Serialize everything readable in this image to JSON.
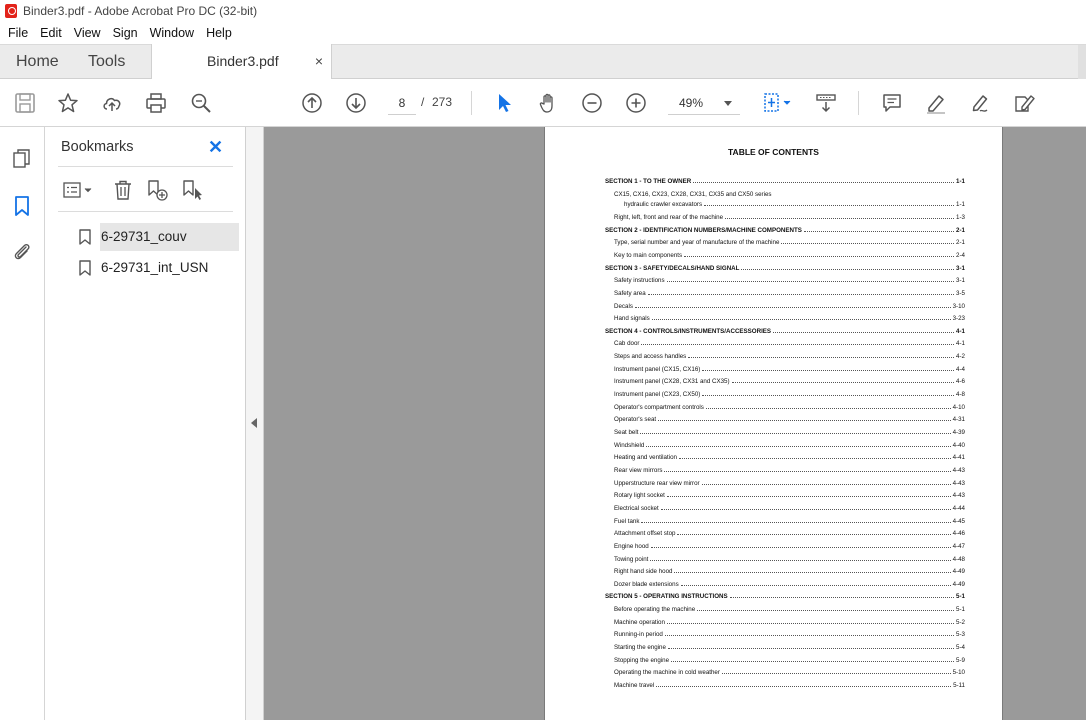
{
  "window": {
    "title": "Binder3.pdf - Adobe Acrobat Pro DC (32-bit)"
  },
  "menu": [
    "File",
    "Edit",
    "View",
    "Sign",
    "Window",
    "Help"
  ],
  "tabs": {
    "home": "Home",
    "tools": "Tools",
    "document": "Binder3.pdf",
    "close": "×"
  },
  "toolbar": {
    "page_current": "8",
    "page_separator": "/",
    "page_total": "273",
    "zoom": "49%"
  },
  "bookmarks": {
    "title": "Bookmarks",
    "items": [
      {
        "label": "6-29731_couv",
        "selected": true
      },
      {
        "label": "6-29731_int_USN",
        "selected": false
      }
    ]
  },
  "document": {
    "toc_title": "TABLE OF CONTENTS",
    "entries": [
      {
        "text": "SECTION 1 - TO THE OWNER",
        "page": "1-1",
        "section": true
      },
      {
        "text": "CX15, CX16, CX23, CX28, CX31, CX35 and CX50 series",
        "page": "",
        "section": false,
        "nodots": true
      },
      {
        "text": "hydraulic crawler excavators",
        "page": "1-1",
        "section": false,
        "indent2": true
      },
      {
        "text": "Right, left, front and rear of the machine",
        "page": "1-3",
        "section": false
      },
      {
        "text": "SECTION 2 - IDENTIFICATION NUMBERS/MACHINE COMPONENTS",
        "page": "2-1",
        "section": true
      },
      {
        "text": "Type, serial number and year of manufacture of the machine",
        "page": "2-1",
        "section": false
      },
      {
        "text": "Key to main components",
        "page": "2-4",
        "section": false
      },
      {
        "text": "SECTION 3 - SAFETY/DECALS/HAND SIGNAL",
        "page": "3-1",
        "section": true
      },
      {
        "text": "Safety instructions",
        "page": "3-1",
        "section": false
      },
      {
        "text": "Safety area",
        "page": "3-5",
        "section": false
      },
      {
        "text": "Decals",
        "page": "3-10",
        "section": false
      },
      {
        "text": "Hand signals",
        "page": "3-23",
        "section": false
      },
      {
        "text": "SECTION 4 - CONTROLS/INSTRUMENTS/ACCESSORIES",
        "page": "4-1",
        "section": true
      },
      {
        "text": "Cab door",
        "page": "4-1",
        "section": false
      },
      {
        "text": "Steps and access handles",
        "page": "4-2",
        "section": false
      },
      {
        "text": "Instrument panel (CX15, CX16)",
        "page": "4-4",
        "section": false
      },
      {
        "text": "Instrument panel (CX28, CX31 and CX35)",
        "page": "4-6",
        "section": false
      },
      {
        "text": "Instrument panel (CX23, CX50)",
        "page": "4-8",
        "section": false
      },
      {
        "text": "Operator's compartment controls",
        "page": "4-10",
        "section": false
      },
      {
        "text": "Operator's seat",
        "page": "4-31",
        "section": false
      },
      {
        "text": "Seat belt",
        "page": "4-39",
        "section": false
      },
      {
        "text": "Windshield",
        "page": "4-40",
        "section": false
      },
      {
        "text": "Heating and ventilation",
        "page": "4-41",
        "section": false
      },
      {
        "text": "Rear view mirrors",
        "page": "4-43",
        "section": false
      },
      {
        "text": "Upperstructure rear view mirror",
        "page": "4-43",
        "section": false
      },
      {
        "text": "Rotary light socket",
        "page": "4-43",
        "section": false
      },
      {
        "text": "Electrical socket",
        "page": "4-44",
        "section": false
      },
      {
        "text": "Fuel tank",
        "page": "4-45",
        "section": false
      },
      {
        "text": "Attachment offset stop",
        "page": "4-46",
        "section": false
      },
      {
        "text": "Engine hood",
        "page": "4-47",
        "section": false
      },
      {
        "text": "Towing point",
        "page": "4-48",
        "section": false
      },
      {
        "text": "Right hand side hood",
        "page": "4-49",
        "section": false
      },
      {
        "text": "Dozer blade extensions",
        "page": "4-49",
        "section": false
      },
      {
        "text": "SECTION 5 - OPERATING INSTRUCTIONS",
        "page": "5-1",
        "section": true
      },
      {
        "text": "Before operating the machine",
        "page": "5-1",
        "section": false
      },
      {
        "text": "Machine operation",
        "page": "5-2",
        "section": false
      },
      {
        "text": "Running-in period",
        "page": "5-3",
        "section": false
      },
      {
        "text": "Starting the engine",
        "page": "5-4",
        "section": false
      },
      {
        "text": "Stopping the engine",
        "page": "5-9",
        "section": false
      },
      {
        "text": "Operating the machine in cold weather",
        "page": "5-10",
        "section": false
      },
      {
        "text": "Machine travel",
        "page": "5-11",
        "section": false
      }
    ]
  },
  "colors": {
    "accent_blue": "#1473e6",
    "doc_background": "#9a9a9a",
    "app_icon_red": "#e2231a"
  }
}
